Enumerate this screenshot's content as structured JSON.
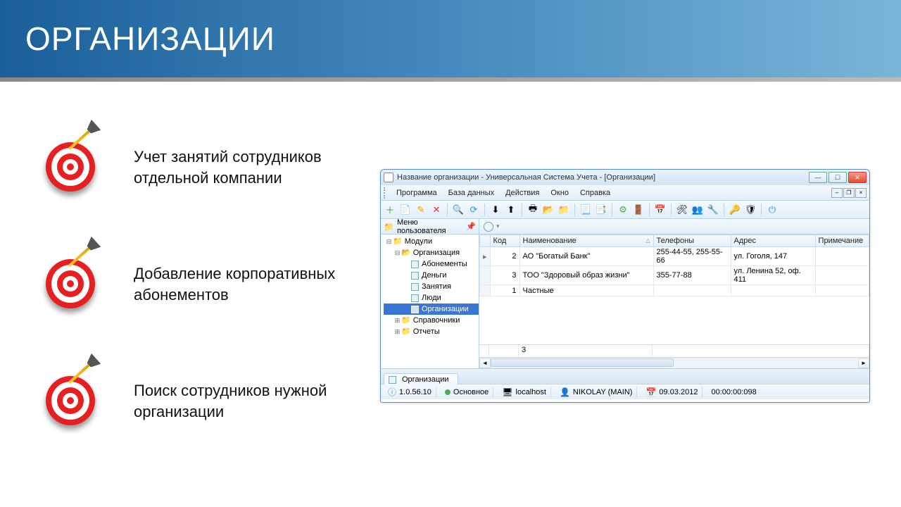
{
  "slide": {
    "title": "ОРГАНИЗАЦИИ",
    "bullets": [
      "Учет занятий сотрудников отдельной компании",
      "Добавление корпоративных абонементов",
      "Поиск сотрудников нужной организации"
    ]
  },
  "app": {
    "title": "Название организации - Универсальная Система Учета - [Организации]",
    "menu": [
      "Программа",
      "База данных",
      "Действия",
      "Окно",
      "Справка"
    ],
    "sidebar": {
      "header": "Меню пользователя",
      "tree": {
        "root": "Модули",
        "org_group": "Организация",
        "items": [
          "Абонементы",
          "Деньги",
          "Занятия",
          "Люди",
          "Организации"
        ],
        "refs": "Справочники",
        "reports": "Отчеты"
      }
    },
    "grid": {
      "columns": [
        "Код",
        "Наименование",
        "Телефоны",
        "Адрес",
        "Примечание"
      ],
      "rows": [
        {
          "code": "2",
          "name": "АО \"Богатый Банк\"",
          "phones": "255-44-55, 255-55-66",
          "address": "ул. Гоголя, 147",
          "note": ""
        },
        {
          "code": "3",
          "name": "ТОО \"Здоровый образ жизни\"",
          "phones": "355-77-88",
          "address": "ул. Ленина 52, оф. 411",
          "note": ""
        },
        {
          "code": "1",
          "name": "Частные",
          "phones": "",
          "address": "",
          "note": ""
        }
      ],
      "summary_count": "3"
    },
    "tab": "Организации",
    "status": {
      "version": "1.0.56.10",
      "main": "Основное",
      "host": "localhost",
      "user": "NIKOLAY (MAIN)",
      "date": "09.03.2012",
      "time": "00:00:00:098"
    }
  }
}
